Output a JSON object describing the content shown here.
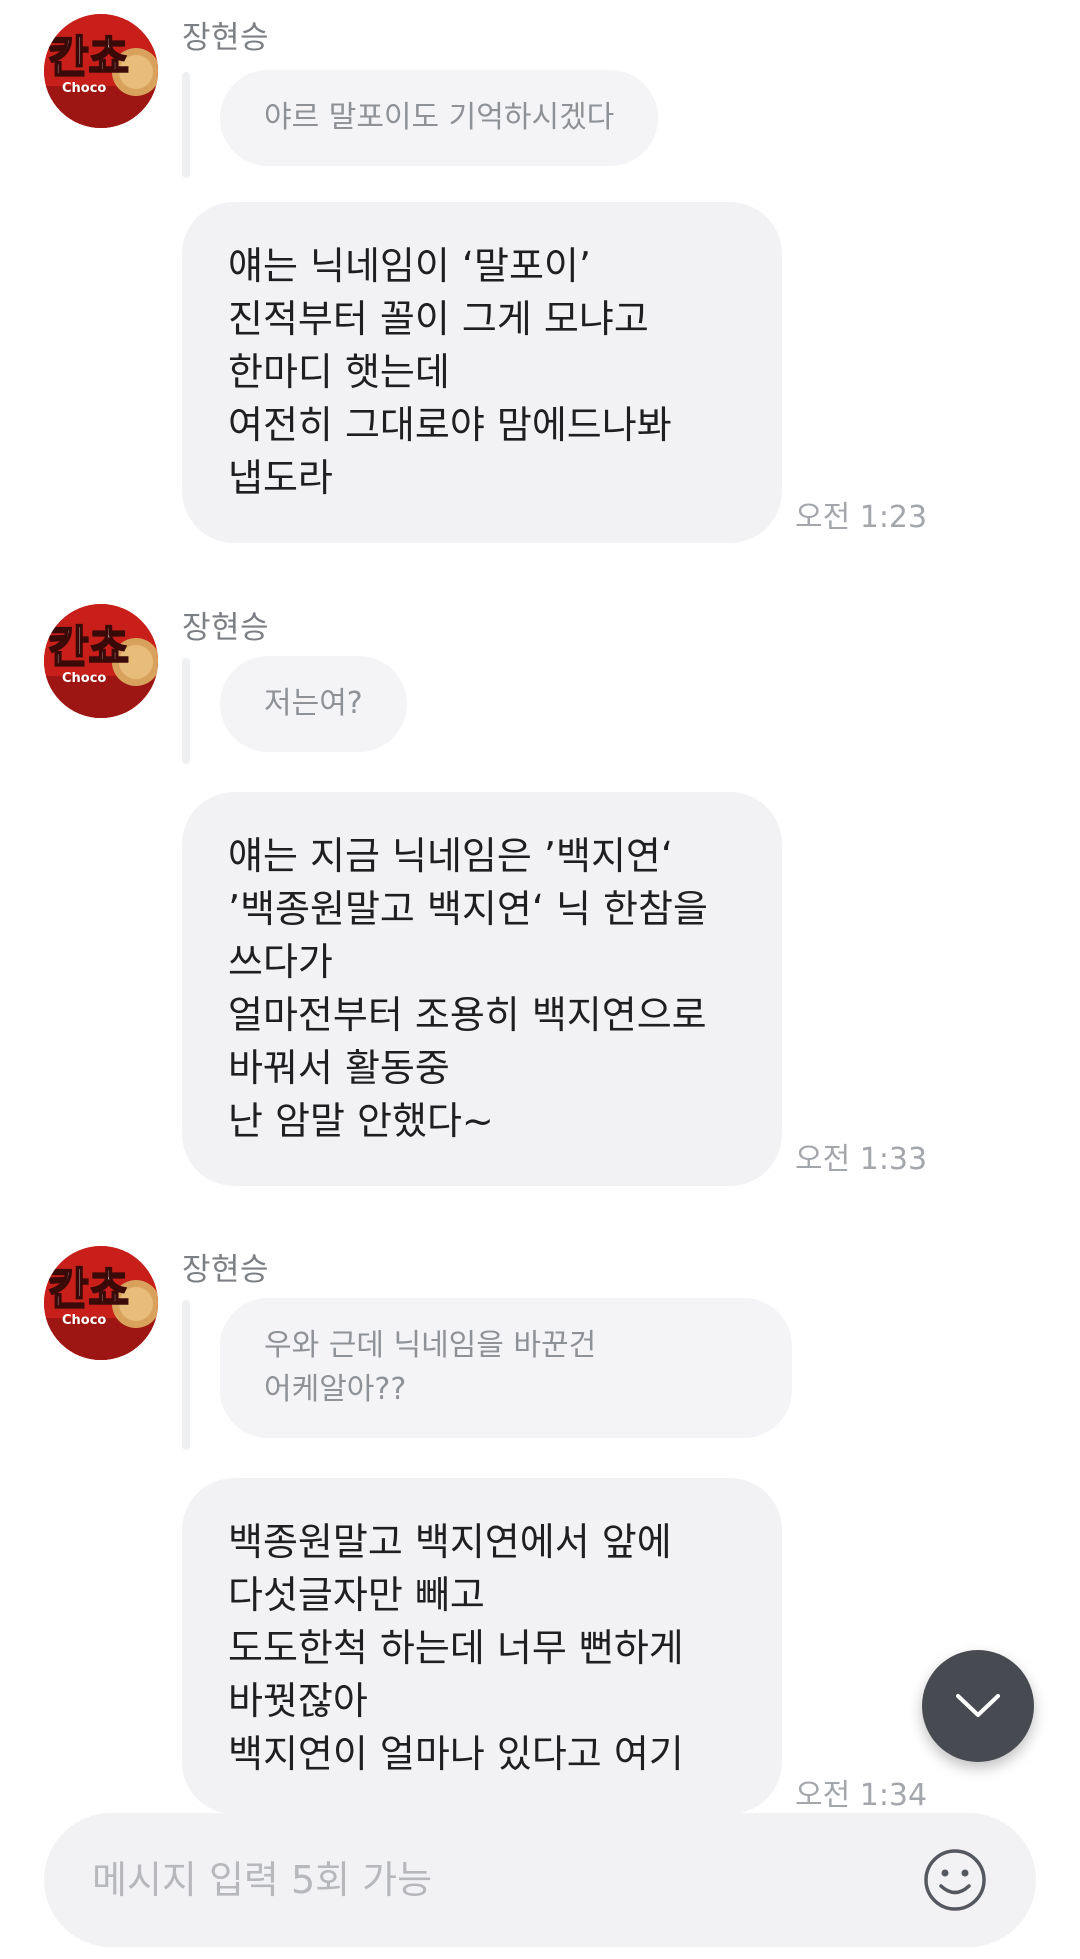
{
  "messages": [
    {
      "sender": "장현승",
      "quote": "야르 말포이도 기억하시겠다",
      "text": "얘는 닉네임이 ‘말포이’\n진적부터 꼴이 그게 모냐고\n한마디 햇는데\n여전히 그대로야 맘에드나봐\n냅도라",
      "time": "오전 1:23"
    },
    {
      "sender": "장현승",
      "quote": "저는여?",
      "text": "얘는 지금 닉네임은 ’백지연‘\n’백종원말고 백지연‘ 닉 한참을\n쓰다가\n얼마전부터 조용히 백지연으로\n바꿔서 활동중\n난 암말 안했다~",
      "time": "오전 1:33"
    },
    {
      "sender": "장현승",
      "quote": "우와 근데 닉네임을 바꾼건\n어케알아??",
      "text": "백종원말고 백지연에서 앞에\n다섯글자만 빼고\n도도한척 하는데 너무 뻔하게\n바꿧잖아\n백지연이 얼마나 있다고 여기",
      "time": "오전 1:34"
    }
  ],
  "avatar": {
    "text": "칸쵸",
    "sub": "Choco"
  },
  "input": {
    "placeholder": "메시지 입력 5회 가능"
  },
  "icons": {
    "scroll": "chevron-down-icon",
    "emoji": "smiley-icon"
  },
  "colors": {
    "bubble": "#f2f2f4",
    "quote": "#f4f4f6",
    "scroll_button": "#474a51",
    "avatar_red": "#c91f1a"
  }
}
